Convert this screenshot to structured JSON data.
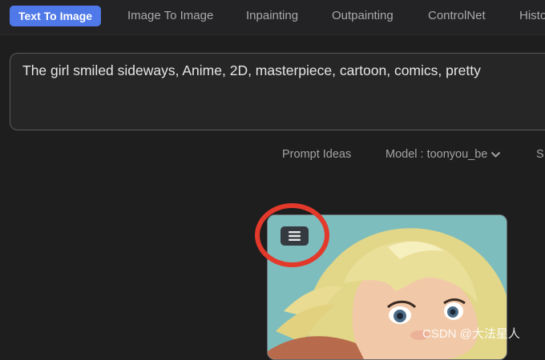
{
  "tabs": [
    {
      "label": "Text To Image",
      "active": true
    },
    {
      "label": "Image To Image",
      "active": false
    },
    {
      "label": "Inpainting",
      "active": false
    },
    {
      "label": "Outpainting",
      "active": false
    },
    {
      "label": "ControlNet",
      "active": false
    },
    {
      "label": "Histo",
      "active": false
    }
  ],
  "prompt": {
    "value": "The girl smiled sideways, Anime, 2D, masterpiece, cartoon, comics, pretty"
  },
  "toolbar": {
    "prompt_ideas": "Prompt Ideas",
    "model_label": "Model : toonyou_be",
    "cut_item": "S"
  },
  "image_card": {
    "menu_icon": "hamburger-menu-icon"
  },
  "watermark": "CSDN @大法星人",
  "colors": {
    "accent": "#4f78e8",
    "highlight": "#e3392b",
    "background": "#1e1e1f"
  }
}
